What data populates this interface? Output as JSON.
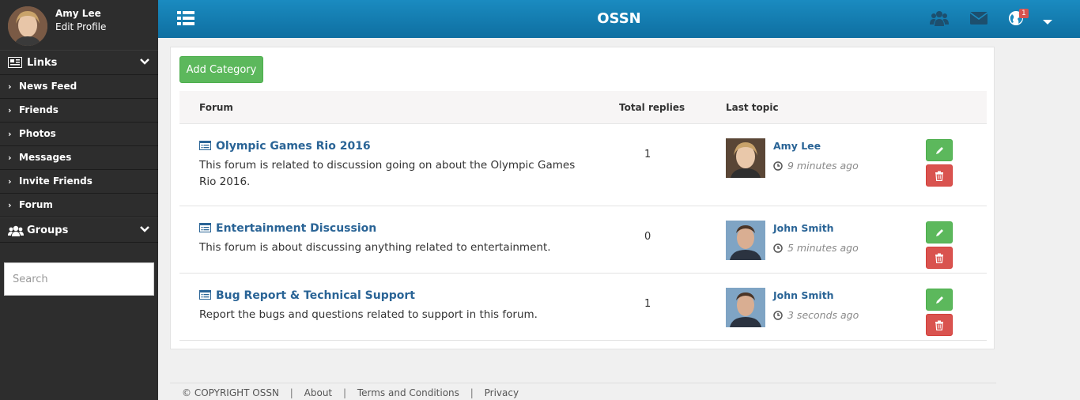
{
  "sidebar": {
    "profile": {
      "name": "Amy Lee",
      "edit_label": "Edit Profile"
    },
    "links_heading": "Links",
    "nav": [
      {
        "label": "News Feed"
      },
      {
        "label": "Friends"
      },
      {
        "label": "Photos"
      },
      {
        "label": "Messages"
      },
      {
        "label": "Invite Friends"
      },
      {
        "label": "Forum"
      }
    ],
    "groups_heading": "Groups",
    "search_placeholder": "Search"
  },
  "topbar": {
    "brand": "OSSN",
    "notification_count": "1",
    "icons": [
      "menu-icon",
      "friends-icon",
      "envelope-icon",
      "globe-icon",
      "caret-down-icon"
    ]
  },
  "forum": {
    "add_button": "Add Category",
    "headers": {
      "forum": "Forum",
      "replies": "Total replies",
      "last_topic": "Last topic"
    },
    "rows": [
      {
        "title": "Olympic Games Rio 2016",
        "description": "This forum is related to discussion going on about the Olympic Games Rio 2016.",
        "replies": "1",
        "author": "Amy Lee",
        "time": "9 minutes ago"
      },
      {
        "title": "Entertainment Discussion",
        "description": "This forum is about discussing anything related to entertainment.",
        "replies": "0",
        "author": "John Smith",
        "time": "5 minutes ago"
      },
      {
        "title": "Bug Report & Technical Support",
        "description": "Report the bugs and questions related to support in this forum.",
        "replies": "1",
        "author": "John Smith",
        "time": "3 seconds ago"
      }
    ]
  },
  "footer": {
    "copyright": "© COPYRIGHT OSSN",
    "links": [
      "About",
      "Terms and Conditions",
      "Privacy"
    ]
  },
  "colors": {
    "topbar": "#1a8bc0",
    "sidebar": "#2d2d2d",
    "success": "#5cb85c",
    "danger": "#d9534f",
    "link": "#2a6496"
  }
}
